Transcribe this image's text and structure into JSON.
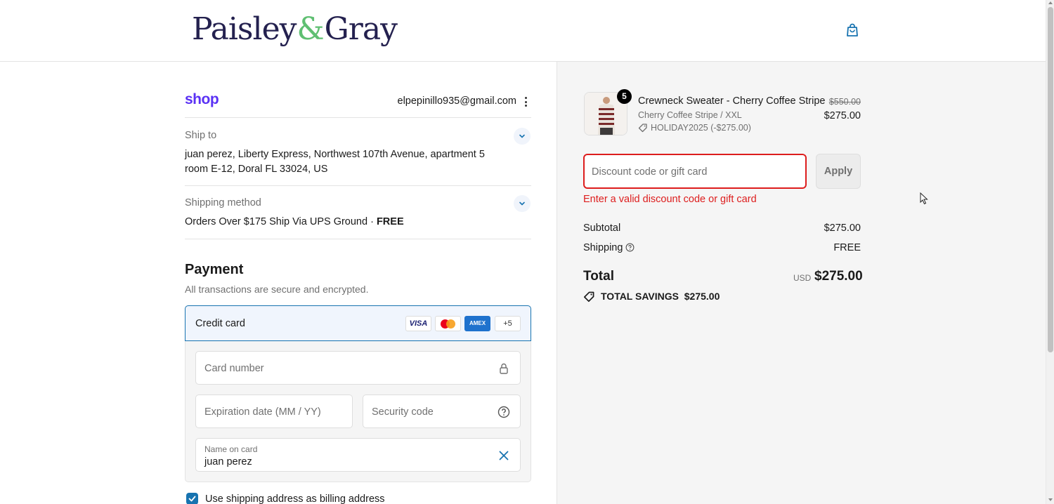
{
  "header": {
    "brand_left": "Paisley",
    "brand_amp": "&",
    "brand_right": "Gray"
  },
  "contact": {
    "shop_logo": "shop",
    "email": "elpepinillo935@gmail.com"
  },
  "ship_to": {
    "label": "Ship to",
    "address": "juan perez, Liberty Express, Northwest 107th Avenue, apartment 5 room E-12, Doral FL 33024, US"
  },
  "shipping_method": {
    "label": "Shipping method",
    "name": "Orders Over $175 Ship Via UPS Ground · ",
    "cost": "FREE"
  },
  "payment": {
    "title": "Payment",
    "subtitle": "All transactions are secure and encrypted.",
    "method_label": "Credit card",
    "card_logos": [
      "VISA",
      "AMEX",
      "+5"
    ],
    "card_number_placeholder": "Card number",
    "expiry_placeholder": "Expiration date (MM / YY)",
    "security_placeholder": "Security code",
    "name_label": "Name on card",
    "name_value": "juan perez",
    "billing_checkbox_label": "Use shipping address as billing address",
    "billing_checked": true
  },
  "order": {
    "item": {
      "quantity": "5",
      "name": "Crewneck Sweater - Cherry Coffee Stripe",
      "variant": "Cherry Coffee Stripe / XXL",
      "discount": "HOLIDAY2025 (-$275.00)",
      "original_price": "$550.00",
      "price": "$275.00"
    },
    "discount_placeholder": "Discount code or gift card",
    "apply_label": "Apply",
    "discount_error": "Enter a valid discount code or gift card",
    "subtotal_label": "Subtotal",
    "subtotal_value": "$275.00",
    "shipping_label": "Shipping",
    "shipping_value": "FREE",
    "total_label": "Total",
    "total_currency": "USD",
    "total_value": "$275.00",
    "savings_label": "TOTAL SAVINGS",
    "savings_value": "$275.00"
  },
  "colors": {
    "accent": "#1773b0",
    "error": "#dd1d1d",
    "shop_purple": "#5a31f4",
    "brand_navy": "#24214f",
    "brand_green": "#5fbf72"
  },
  "icons": [
    "bag-icon",
    "kebab-icon",
    "chevron-down-icon",
    "lock-icon",
    "help-circle-icon",
    "close-icon",
    "check-icon",
    "tag-icon",
    "cursor-icon"
  ]
}
